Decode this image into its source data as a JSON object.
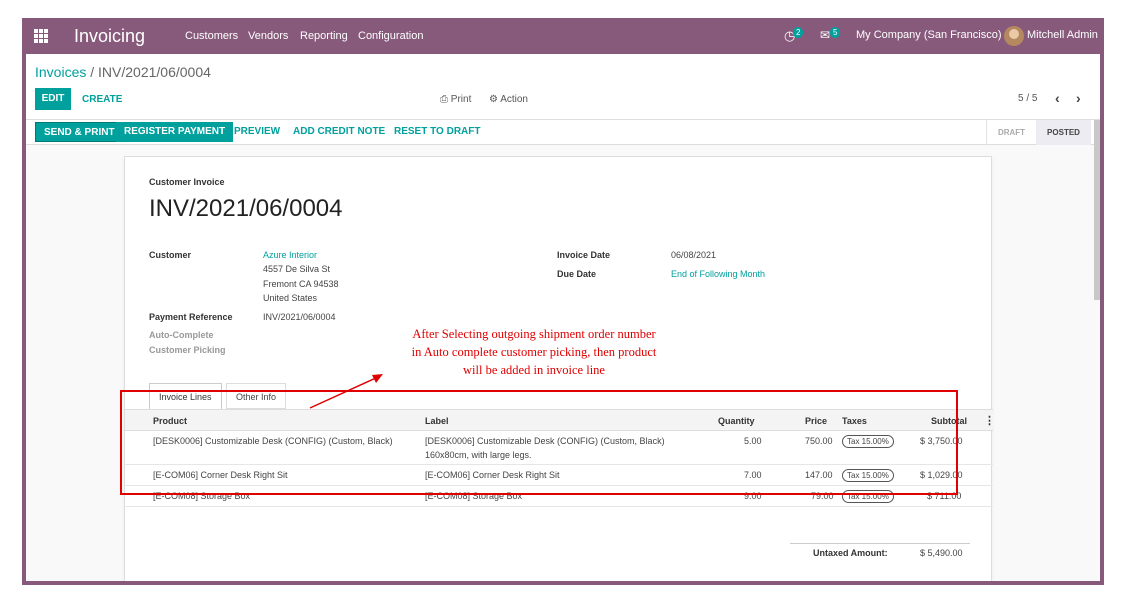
{
  "navbar": {
    "app_name": "Invoicing",
    "menu": [
      "Customers",
      "Vendors",
      "Reporting",
      "Configuration"
    ],
    "activity_count": "2",
    "messages_count": "5",
    "company": "My Company (San Francisco)",
    "user": "Mitchell Admin"
  },
  "control_panel": {
    "breadcrumb_parent": "Invoices",
    "breadcrumb_sep": "/",
    "breadcrumb_current": "INV/2021/06/0004",
    "edit": "EDIT",
    "create": "CREATE",
    "print": "Print",
    "action": "Action",
    "pager": "5 / 5"
  },
  "statusbar": {
    "send_print": "SEND & PRINT",
    "register_payment": "REGISTER PAYMENT",
    "preview": "PREVIEW",
    "add_credit_note": "ADD CREDIT NOTE",
    "reset_to_draft": "RESET TO DRAFT",
    "stage_draft": "DRAFT",
    "stage_posted": "POSTED"
  },
  "invoice": {
    "type": "Customer Invoice",
    "name": "INV/2021/06/0004",
    "customer_label": "Customer",
    "customer_name": "Azure Interior",
    "address_line1": "4557 De Silva St",
    "address_line2": "Fremont CA 94538",
    "address_line3": "United States",
    "payment_ref_label": "Payment Reference",
    "payment_ref": "INV/2021/06/0004",
    "autocomplete_label_1": "Auto-Complete",
    "autocomplete_label_2": "Customer Picking",
    "invoice_date_label": "Invoice Date",
    "invoice_date": "06/08/2021",
    "due_date_label": "Due Date",
    "due_date": "End of Following Month"
  },
  "tabs": [
    "Invoice Lines",
    "Other Info"
  ],
  "lines_table": {
    "headers": [
      "Product",
      "Label",
      "Quantity",
      "Price",
      "Taxes",
      "Subtotal"
    ],
    "rows": [
      {
        "product": "[DESK0006] Customizable Desk (CONFIG) (Custom, Black)",
        "label1": "[DESK0006] Customizable Desk (CONFIG) (Custom, Black)",
        "label2": "160x80cm, with large legs.",
        "qty": "5.00",
        "price": "750.00",
        "tax": "Tax 15.00%",
        "subtotal": "$ 3,750.00"
      },
      {
        "product": "[E-COM06] Corner Desk Right Sit",
        "label1": "[E-COM06] Corner Desk Right Sit",
        "label2": "",
        "qty": "7.00",
        "price": "147.00",
        "tax": "Tax 15.00%",
        "subtotal": "$ 1,029.00"
      },
      {
        "product": "[E-COM08] Storage Box",
        "label1": "[E-COM08] Storage Box",
        "label2": "",
        "qty": "9.00",
        "price": "79.00",
        "tax": "Tax 15.00%",
        "subtotal": "$ 711.00"
      }
    ]
  },
  "totals": {
    "untaxed_label": "Untaxed Amount:",
    "untaxed_value": "$ 5,490.00"
  },
  "annotation": {
    "line1": "After Selecting outgoing shipment order number",
    "line2": "in Auto complete customer picking, then product",
    "line3": "will be added in invoice line",
    "color": "#e00000"
  },
  "colors": {
    "brand": "#875a7b",
    "accent": "#00a09d"
  }
}
